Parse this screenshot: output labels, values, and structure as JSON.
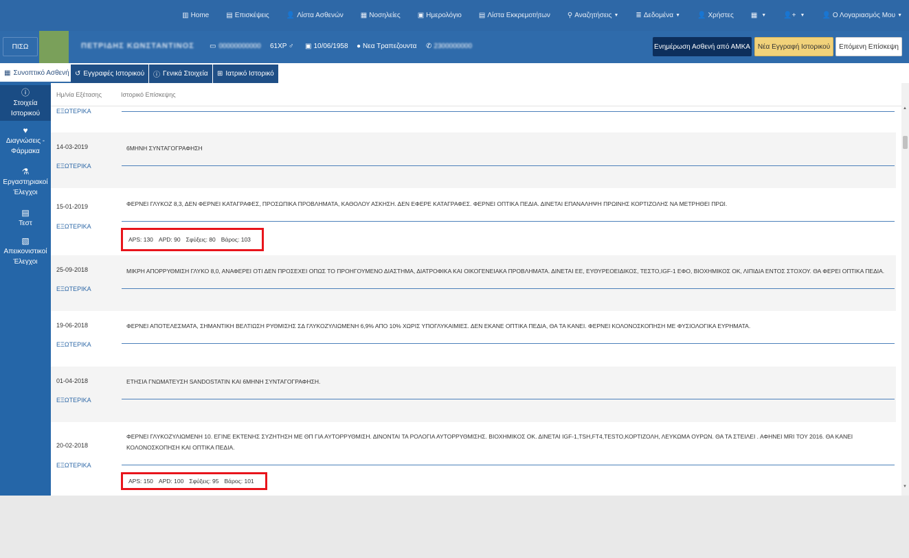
{
  "nav": {
    "items": [
      {
        "icon": "building-icon",
        "glyph": "▥",
        "label": "Home"
      },
      {
        "icon": "document-icon",
        "glyph": "▤",
        "label": "Επισκέψεις"
      },
      {
        "icon": "user-icon",
        "glyph": "👤",
        "label": "Λίστα Ασθενών"
      },
      {
        "icon": "hospital-icon",
        "glyph": "▦",
        "label": "Νοσηλείες"
      },
      {
        "icon": "calendar-icon",
        "glyph": "▣",
        "label": "Ημερολόγιο"
      },
      {
        "icon": "clipboard-icon",
        "glyph": "▤",
        "label": "Λίστα Εκκρεμοτήτων"
      },
      {
        "icon": "search-icon",
        "glyph": "⚲",
        "label": "Αναζητήσεις",
        "dropdown": true
      },
      {
        "icon": "database-icon",
        "glyph": "≣",
        "label": "Δεδομένα",
        "dropdown": true
      },
      {
        "icon": "users-icon",
        "glyph": "👤",
        "label": "Χρήστες"
      },
      {
        "icon": "grid-icon",
        "glyph": "▦",
        "label": "",
        "dropdown": true
      },
      {
        "icon": "add-user-icon",
        "glyph": "👤+",
        "label": "",
        "dropdown": true
      },
      {
        "icon": "account-icon",
        "glyph": "👤",
        "label": "Ο Λογαριασμός Μου",
        "dropdown": true
      }
    ]
  },
  "patient": {
    "piso_label": "ΠΙΣΩ",
    "name": "ΠΕΤΡΙΔΗΣ ΚΩΝΣΤΑΝΤΙΝΟΣ",
    "amka": "00000000000",
    "age_gender": "61ΧΡ ♂",
    "birthdate": "10/06/1958",
    "city": "Νεα Τραπεζουντα",
    "phone": "2300000000",
    "btn_amka": "Ενημέρωση Ασθενή από ΑΜΚΑ",
    "btn_new": "Νέα Εγγραφή Ιστορικού",
    "btn_next": "Επόμενη Επίσκεψη"
  },
  "tabs": [
    {
      "label": "Συνοπτικό Ασθενή",
      "icon": "grid-icon"
    },
    {
      "label": "Εγγραφές Ιστορικού",
      "icon": "history-icon"
    },
    {
      "label": "Γενικά Στοιχεία",
      "icon": "info-icon"
    },
    {
      "label": "Ιατρικό Ιστορικό",
      "icon": "plus-square-icon"
    }
  ],
  "sidebar": {
    "items": [
      {
        "label1": "Στοιχεία",
        "label2": "Ιστορικού",
        "icon": "info-circle-icon"
      },
      {
        "label1": "Διαγνώσεις -",
        "label2": "Φάρμακα",
        "icon": "stethoscope-icon"
      },
      {
        "label1": "Εργαστηριακοί",
        "label2": "Έλεγχοι",
        "icon": "flask-icon"
      },
      {
        "label1": "Τεστ",
        "label2": "",
        "icon": "clipboard-icon"
      },
      {
        "label1": "Απεικονιστικοί",
        "label2": "Έλεγχοι",
        "icon": "image-file-icon"
      }
    ]
  },
  "table": {
    "col_date": "Ημ/νία Εξέτασης",
    "col_history": "Ιστορικό Επίσκεψης",
    "top_partial_type": "ΕΞΩΤΕΡΙΚΑ",
    "rows": [
      {
        "date": "14-03-2019",
        "type": "ΕΞΩΤΕΡΙΚΑ",
        "text": "6ΜΗΝΗ ΣΥΝΤΑΓΟΓΡΑΦΗΣΗ"
      },
      {
        "date": "15-01-2019",
        "type": "ΕΞΩΤΕΡΙΚΑ",
        "text": "ΦΕΡΝΕΙ ΓΛΥΚΟΖ 8,3, ΔΕΝ ΦΕΡΝΕΙ ΚΑΤΑΓΡΑΦΕΣ, ΠΡΟΣΩΠΙΚΑ ΠΡΟΒΛΗΜΑΤΑ, ΚΑΘΟΛΟΥ ΑΣΚΗΣΗ. ΔΕΝ ΕΦΕΡΕ ΚΑΤΑΓΡΑΦΕΣ. ΦΕΡΝΕΙ ΟΠΤΙΚΑ ΠΕΔΙΑ. ΔΙΝΕΤΑΙ ΕΠΑΝΑΛΗΨΗ ΠΡΩΙΝΗΣ ΚΟΡΤΙΖΟΛΗΣ ΝΑ ΜΕΤΡΗΘΕΙ ΠΡΩΙ.",
        "vitals": {
          "aps": "APS: 130",
          "apd": "APD: 90",
          "pulse": "Σφύξεις: 80",
          "weight": "Βάρος: 103"
        }
      },
      {
        "date": "25-09-2018",
        "type": "ΕΞΩΤΕΡΙΚΑ",
        "text": "ΜΙΚΡΗ ΑΠΟΡΡΥΘΜΙΣΗ ΓΛΥΚΟ 8,0, ΑΝΑΦΕΡΕΙ ΟΤΙ ΔΕΝ ΠΡΟΣΕΧΕΙ ΟΠΩΣ ΤΟ ΠΡΟΗΓΟΥΜΕΝΟ ΔΙΑΣΤΗΜΑ, ΔΙΑΤΡΟΦΙΚΑ ΚΑΙ ΟΙΚΟΓΕΝΕΙΑΚΑ ΠΡΟΒΛΗΜΑΤΑ. ΔΙΝΕΤΑΙ ΕΕ, ΕΥΘΥΡΕΟΕΙΔΙΚΟΣ, ΤΕΣΤΟ,IGF-1 ΕΦΟ, ΒΙΟΧΗΜΙΚΟΣ ΟΚ, ΛΙΠΙΔΙΑ ΕΝΤΟΣ ΣΤΟΧΟΥ. ΘΑ ΦΕΡΕΙ ΟΠΤΙΚΑ ΠΕΔΙΑ."
      },
      {
        "date": "19-06-2018",
        "type": "ΕΞΩΤΕΡΙΚΑ",
        "text": "ΦΕΡΝΕΙ ΑΠΟΤΕΛΕΣΜΑΤΑ, ΣΗΜΑΝΤΙΚΗ ΒΕΛΤΙΩΣΗ ΡΥΘΜΙΣΗΣ ΣΔ ΓΛΥΚΟΖΥΛΙΩΜΕΝΗ 6,9% ΑΠΟ 10% ΧΩΡΙΣ ΥΠΟΓΛΥΚΑΙΜΙΕΣ. ΔΕΝ ΕΚΑΝΕ ΟΠΤΙΚΑ ΠΕΔΙΑ, ΘΑ ΤΑ ΚΑΝΕΙ. ΦΕΡΝΕΙ ΚΟΛΟΝΟΣΚΟΠΗΣΗ ΜΕ ΦΥΣΙΟΛΟΓΙΚΑ ΕΥΡΗΜΑΤΑ."
      },
      {
        "date": "01-04-2018",
        "type": "ΕΞΩΤΕΡΙΚΑ",
        "text": "ΕΤΗΣΙΑ ΓΝΩΜΑΤΕΥΣΗ SANDOSTATIN ΚΑΙ 6ΜΗΝΗ ΣΥΝΤΑΓΟΓΡΑΦΗΣΗ."
      },
      {
        "date": "20-02-2018",
        "type": "ΕΞΩΤΕΡΙΚΑ",
        "text": "ΦΕΡΝΕΙ ΓΛΥΚΟΖΥΛΙΩΜΕΝΗ 10. ΕΓΙΝΕ ΕΚΤΕΝΗΣ ΣΥΖΗΤΗΣΗ ΜΕ ΘΠ ΓΙΑ ΑΥΤΟΡΡΥΘΜΙΣΗ. ΔΙΝΟΝΤΑΙ ΤΑ ΡΟΛΟΓΙΑ ΑΥΤΟΡΡΥΘΜΙΣΗΣ. ΒΙΟΧΗΜΙΚΟΣ ΟΚ. ΔΙΝΕΤΑΙ IGF-1,TSH,FT4,TESTO,ΚΟΡΤΙΖΟΛΗ, ΛΕΥΚΩΜΑ ΟΥΡΩΝ. ΘΑ ΤΑ ΣΤΕΙΛΕΙ . ΑΦΗΝΕΙ MRI ΤΟΥ 2016. ΘΑ ΚΑΝΕΙ ΚΟΛΟΝΟΣΚΟΠΗΣΗ ΚΑΙ ΟΠΤΙΚΑ ΠΕΔΙΑ.",
        "vitals": {
          "aps": "APS: 150",
          "apd": "APD: 100",
          "pulse": "Σφύξεις: 95",
          "weight": "Βάρος: 101"
        }
      }
    ]
  },
  "colors": {
    "nav": "#2e68a7",
    "sidebar": "#2566a8",
    "highlight": "#e8141b",
    "btn_new": "#f1d27a",
    "btn_amka": "#0d2f5c"
  }
}
